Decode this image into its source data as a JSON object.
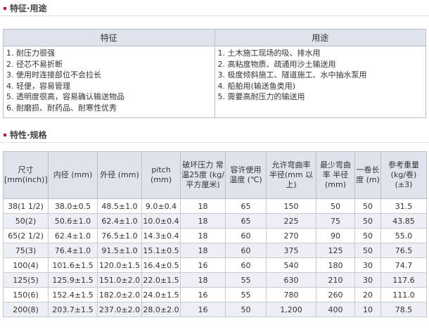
{
  "features_section": {
    "title": "特征·用途",
    "table": {
      "col_features": "特征",
      "col_uses": "用途",
      "features": [
        "1. 耐压力很强",
        "2. 径芯不易折断",
        "3. 使用时连接部位不会拉长",
        "4. 轻便，容易管理",
        "5. 透明度很高，容易确认输送物品",
        "6. 耐磨损、耐药品、耐寒性优秀"
      ],
      "uses": [
        "1. 土木施工现场的吸、排水用",
        "2. 高粘度物质、疏通用沙土输送用",
        "3. 极度倾斜施工、隧道施工、水中抽水泵用",
        "4. 船舶用(输送鱼类用)",
        "5. 需要高耐压力的输送用"
      ]
    }
  },
  "specs_section": {
    "title": "特性·规格",
    "headers": [
      "尺寸 [mm(inch)]",
      "内径 (mm)",
      "外径 (mm)",
      "pitch (mm)",
      "破坏压力 常温25度 (kg/平方厘米)",
      "容许使用 温度 (℃)",
      "允许弯曲率 半径(mm 以上)",
      "最少弯曲率 半径 (mm)",
      "一卷长度 (m)",
      "参考重量 (kg/卷) (±3)"
    ],
    "rows": [
      [
        "38(1 1/2)",
        "38.0±0.5",
        "48.5±1.0",
        "9.0±0.4",
        "18",
        "65",
        "150",
        "50",
        "50",
        "31.5"
      ],
      [
        "50(2)",
        "50.6±1.0",
        "62.4±1.0",
        "10.0±0.4",
        "18",
        "65",
        "225",
        "75",
        "50",
        "43.85"
      ],
      [
        "65(2 1/2)",
        "62.4±1.0",
        "76.5±1.0",
        "14.3±0.4",
        "18",
        "60",
        "270",
        "90",
        "50",
        "55.0"
      ],
      [
        "75(3)",
        "76.4±1.0",
        "91.5±1.0",
        "15.1±0.5",
        "18",
        "60",
        "375",
        "125",
        "50",
        "76.5"
      ],
      [
        "100(4)",
        "101.6±1.5",
        "120.0±1.5",
        "16.4±0.5",
        "16",
        "60",
        "540",
        "180",
        "30",
        "74.7"
      ],
      [
        "125(5)",
        "125.9±1.5",
        "151.0±2.0",
        "22.0±1.5",
        "18",
        "55",
        "630",
        "210",
        "30",
        "117.6"
      ],
      [
        "150(6)",
        "152.4±1.5",
        "182.0±2.0",
        "24.0±1.5",
        "16",
        "55",
        "780",
        "260",
        "20",
        "111.0"
      ],
      [
        "200(8)",
        "203.7±1.5",
        "237.0±2.0",
        "28.0±2.0",
        "16",
        "50",
        "1,200",
        "400",
        "10",
        "78.5"
      ]
    ]
  }
}
